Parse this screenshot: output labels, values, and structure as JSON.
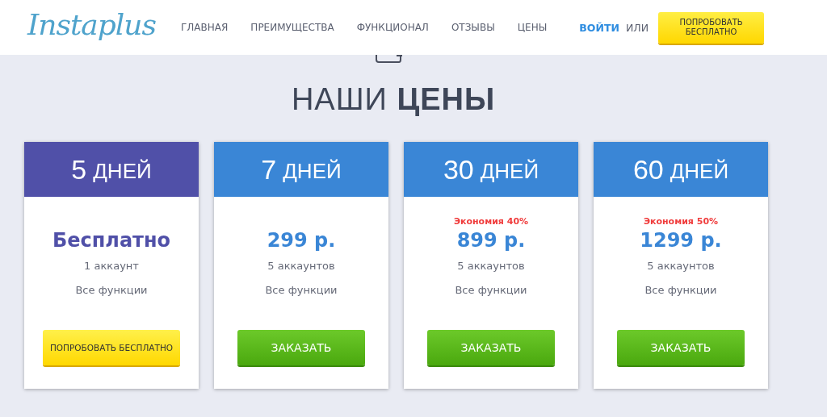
{
  "header": {
    "logo": "Instaplus",
    "nav": [
      "ГЛАВНАЯ",
      "ПРЕИМУЩЕСТВА",
      "ФУНКЦИОНАЛ",
      "ОТЗЫВЫ",
      "ЦЕНЫ"
    ],
    "login": "ВОЙТИ",
    "or": "ИЛИ",
    "cta": "ПОПРОБОВАТЬ БЕСПЛАТНО"
  },
  "section": {
    "title": "НАШИ **ЦЕНЫ**"
  },
  "plans": [
    {
      "kind": "trial",
      "days": "5",
      "unit": "ДНЕЙ",
      "price": "Бесплатно",
      "accounts": "1 аккаунт",
      "features": "Все функции",
      "button": "ПОПРОБОВАТЬ БЕСПЛАТНО"
    },
    {
      "kind": "paid",
      "days": "7",
      "unit": "ДНЕЙ",
      "price": "299 р.",
      "accounts": "5 аккаунтов",
      "features": "Все функции",
      "button": "ЗАКАЗАТЬ"
    },
    {
      "kind": "paid",
      "days": "30",
      "unit": "ДНЕЙ",
      "saving": "Экономия 40%",
      "price": "899 р.",
      "accounts": "5 аккаунтов",
      "features": "Все функции",
      "button": "ЗАКАЗАТЬ"
    },
    {
      "kind": "paid",
      "days": "60",
      "unit": "ДНЕЙ",
      "saving": "Экономия 50%",
      "price": "1299 р.",
      "accounts": "5 аккаунтов",
      "features": "Все функции",
      "button": "ЗАКАЗАТЬ"
    }
  ]
}
